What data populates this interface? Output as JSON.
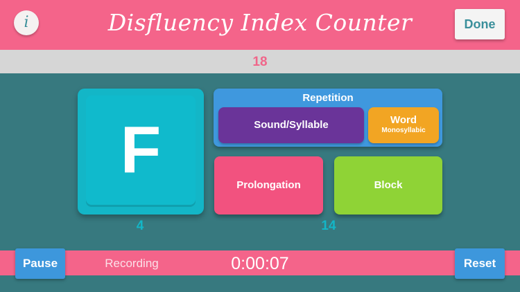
{
  "header": {
    "info_label": "i",
    "title": "Disfluency Index Counter",
    "done_label": "Done"
  },
  "total_count": "18",
  "buttons": {
    "fluent_label": "F",
    "repetition_title": "Repetition",
    "sound_syllable_label": "Sound/Syllable",
    "word_label": "Word",
    "word_sublabel": "Monosyllabic",
    "prolongation_label": "Prolongation",
    "block_label": "Block"
  },
  "counts": {
    "fluent": "4",
    "disfluent": "14"
  },
  "footer": {
    "pause_label": "Pause",
    "status": "Recording",
    "timer": "0:00:07",
    "reset_label": "Reset"
  },
  "colors": {
    "header_pink": "#f4648a",
    "background_teal": "#37797f",
    "fluent_cyan": "#13b6c7",
    "repetition_blue": "#3f98de",
    "sound_purple": "#6a3499",
    "word_orange": "#f2a523",
    "prolongation_pink": "#f2527f",
    "block_green": "#8fd336"
  }
}
